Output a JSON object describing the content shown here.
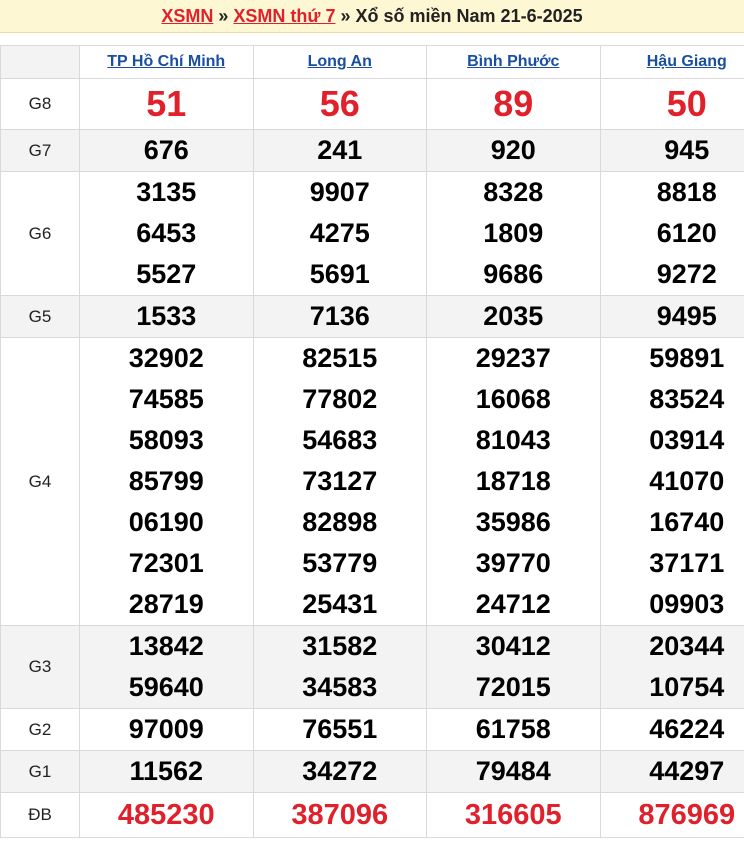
{
  "header": {
    "link1": "XSMN",
    "sep1": "»",
    "link2": "XSMN thứ 7",
    "sep2": "»",
    "title": "Xổ số miền Nam 21-6-2025"
  },
  "provinces": [
    "TP Hồ Chí Minh",
    "Long An",
    "Bình Phước",
    "Hậu Giang"
  ],
  "prizes": [
    {
      "label": "G8",
      "values": [
        [
          "51"
        ],
        [
          "56"
        ],
        [
          "89"
        ],
        [
          "50"
        ]
      ]
    },
    {
      "label": "G7",
      "values": [
        [
          "676"
        ],
        [
          "241"
        ],
        [
          "920"
        ],
        [
          "945"
        ]
      ]
    },
    {
      "label": "G6",
      "values": [
        [
          "3135",
          "6453",
          "5527"
        ],
        [
          "9907",
          "4275",
          "5691"
        ],
        [
          "8328",
          "1809",
          "9686"
        ],
        [
          "8818",
          "6120",
          "9272"
        ]
      ]
    },
    {
      "label": "G5",
      "values": [
        [
          "1533"
        ],
        [
          "7136"
        ],
        [
          "2035"
        ],
        [
          "9495"
        ]
      ]
    },
    {
      "label": "G4",
      "values": [
        [
          "32902",
          "74585",
          "58093",
          "85799",
          "06190",
          "72301",
          "28719"
        ],
        [
          "82515",
          "77802",
          "54683",
          "73127",
          "82898",
          "53779",
          "25431"
        ],
        [
          "29237",
          "16068",
          "81043",
          "18718",
          "35986",
          "39770",
          "24712"
        ],
        [
          "59891",
          "83524",
          "03914",
          "41070",
          "16740",
          "37171",
          "09903"
        ]
      ]
    },
    {
      "label": "G3",
      "values": [
        [
          "13842",
          "59640"
        ],
        [
          "31582",
          "34583"
        ],
        [
          "30412",
          "72015"
        ],
        [
          "20344",
          "10754"
        ]
      ]
    },
    {
      "label": "G2",
      "values": [
        [
          "97009"
        ],
        [
          "76551"
        ],
        [
          "61758"
        ],
        [
          "46224"
        ]
      ]
    },
    {
      "label": "G1",
      "values": [
        [
          "11562"
        ],
        [
          "34272"
        ],
        [
          "79484"
        ],
        [
          "44297"
        ]
      ]
    },
    {
      "label": "ĐB",
      "values": [
        [
          "485230"
        ],
        [
          "387096"
        ],
        [
          "316605"
        ],
        [
          "876969"
        ]
      ]
    }
  ]
}
